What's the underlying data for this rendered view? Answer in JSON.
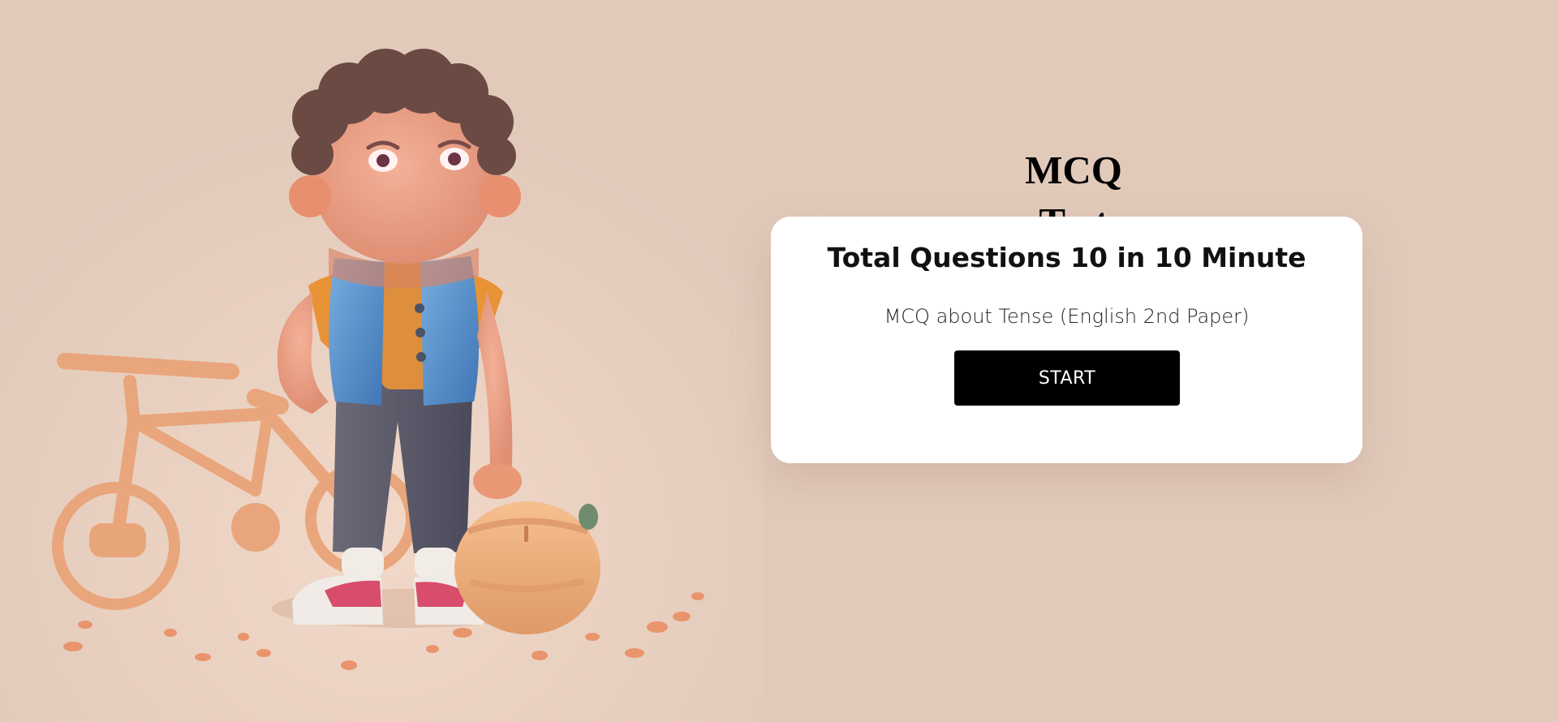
{
  "header": {
    "title": "MCQ Test"
  },
  "card": {
    "title": "Total Questions 10 in 10 Minute",
    "subtitle": "MCQ about Tense (English 2nd Paper)",
    "start_label": "START"
  },
  "illustration": {
    "description_icon": "boy-with-bicycle-illustration"
  },
  "colors": {
    "background": "#e2cabb",
    "card": "#ffffff",
    "button": "#000000",
    "button_text": "#ffffff"
  }
}
